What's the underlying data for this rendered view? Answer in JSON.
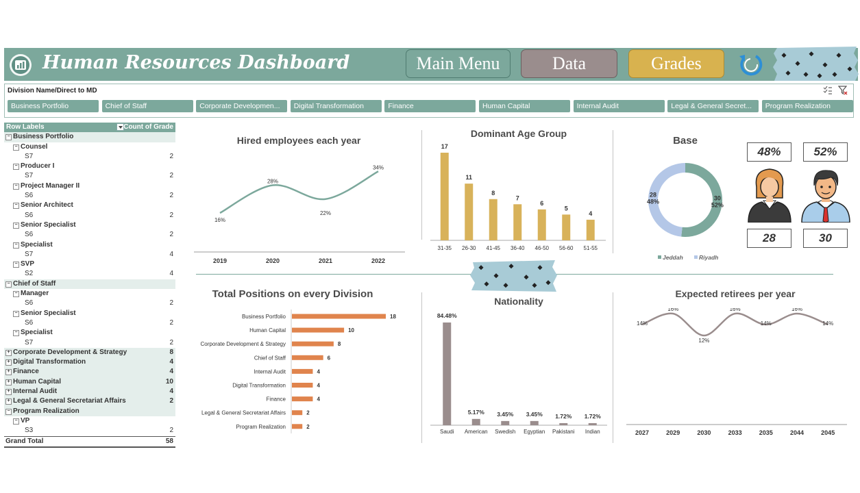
{
  "header": {
    "title": "Human Resources Dashboard",
    "main_menu": "Main Menu",
    "data": "Data",
    "grades": "Grades",
    "color": "#7ca89c"
  },
  "slicer": {
    "title": "Division Name/Direct to MD",
    "items": [
      "Business Portfolio",
      "Chief of Staff",
      "Corporate Developmen...",
      "Digital Transformation",
      "Finance",
      "Human Capital",
      "Internal Audit",
      "Legal & General Secret...",
      "Program Realization"
    ]
  },
  "pivot": {
    "header_label": "Row Labels",
    "header_value": "Count of Grade",
    "rows": [
      {
        "label": "Business Portfolio",
        "value": "",
        "level": 0,
        "sign": "⊟"
      },
      {
        "label": "Counsel",
        "value": "",
        "level": 1,
        "sign": "⊟"
      },
      {
        "label": "S7",
        "value": "2",
        "level": 2,
        "sign": ""
      },
      {
        "label": "Producer I",
        "value": "",
        "level": 1,
        "sign": "⊟"
      },
      {
        "label": "S7",
        "value": "2",
        "level": 2,
        "sign": ""
      },
      {
        "label": "Project Manager II",
        "value": "",
        "level": 1,
        "sign": "⊟"
      },
      {
        "label": "S6",
        "value": "2",
        "level": 2,
        "sign": ""
      },
      {
        "label": "Senior Architect",
        "value": "",
        "level": 1,
        "sign": "⊟"
      },
      {
        "label": "S6",
        "value": "2",
        "level": 2,
        "sign": ""
      },
      {
        "label": "Senior Specialist",
        "value": "",
        "level": 1,
        "sign": "⊟"
      },
      {
        "label": "S6",
        "value": "2",
        "level": 2,
        "sign": ""
      },
      {
        "label": "Specialist",
        "value": "",
        "level": 1,
        "sign": "⊟"
      },
      {
        "label": "S7",
        "value": "4",
        "level": 2,
        "sign": ""
      },
      {
        "label": "SVP",
        "value": "",
        "level": 1,
        "sign": "⊟"
      },
      {
        "label": "S2",
        "value": "4",
        "level": 2,
        "sign": ""
      },
      {
        "label": "Chief of Staff",
        "value": "",
        "level": 0,
        "sign": "⊟"
      },
      {
        "label": "Manager",
        "value": "",
        "level": 1,
        "sign": "⊟"
      },
      {
        "label": "S6",
        "value": "2",
        "level": 2,
        "sign": ""
      },
      {
        "label": "Senior Specialist",
        "value": "",
        "level": 1,
        "sign": "⊟"
      },
      {
        "label": "S6",
        "value": "2",
        "level": 2,
        "sign": ""
      },
      {
        "label": "Specialist",
        "value": "",
        "level": 1,
        "sign": "⊟"
      },
      {
        "label": "S7",
        "value": "2",
        "level": 2,
        "sign": ""
      },
      {
        "label": "Corporate Development & Strategy",
        "value": "8",
        "level": 0,
        "sign": "⊞"
      },
      {
        "label": "Digital Transformation",
        "value": "4",
        "level": 0,
        "sign": "⊞"
      },
      {
        "label": "Finance",
        "value": "4",
        "level": 0,
        "sign": "⊞"
      },
      {
        "label": "Human Capital",
        "value": "10",
        "level": 0,
        "sign": "⊞"
      },
      {
        "label": "Internal Audit",
        "value": "4",
        "level": 0,
        "sign": "⊞"
      },
      {
        "label": "Legal & General Secretariat Affairs",
        "value": "2",
        "level": 0,
        "sign": "⊞"
      },
      {
        "label": "Program Realization",
        "value": "",
        "level": 0,
        "sign": "⊟"
      },
      {
        "label": "VP",
        "value": "",
        "level": 1,
        "sign": "⊟"
      },
      {
        "label": "S3",
        "value": "2",
        "level": 2,
        "sign": ""
      }
    ],
    "grand_total_label": "Grand Total",
    "grand_total_value": "58"
  },
  "base": {
    "title": "Base",
    "female_pct": "48%",
    "male_pct": "52%",
    "female_count": "28",
    "male_count": "30"
  },
  "chart_data": [
    {
      "type": "line",
      "title": "Hired employees each year",
      "categories": [
        "2019",
        "2020",
        "2021",
        "2022"
      ],
      "values": [
        16,
        28,
        22,
        34
      ],
      "labels": [
        "16%",
        "28%",
        "22%",
        "34%"
      ],
      "color": "#7ca89c"
    },
    {
      "type": "bar",
      "title": "Dominant Age Group",
      "categories": [
        "31-35",
        "26-30",
        "41-45",
        "36-40",
        "46-50",
        "56-60",
        "51-55"
      ],
      "values": [
        17,
        11,
        8,
        7,
        6,
        5,
        4
      ],
      "color": "#d8b25a"
    },
    {
      "type": "pie",
      "title": "Base",
      "categories": [
        "Jeddah",
        "Riyadh"
      ],
      "values": [
        30,
        28
      ],
      "labels": [
        [
          "30",
          "52%"
        ],
        [
          "28",
          "48%"
        ]
      ],
      "colors": [
        "#7ca89c",
        "#b4c7e7"
      ]
    },
    {
      "type": "bar",
      "title": "Total Positions on every Division",
      "categories": [
        "Business Portfolio",
        "Human Capital",
        "Corporate Development & Strategy",
        "Chief of Staff",
        "Internal Audit",
        "Digital Transformation",
        "Finance",
        "Legal & General Secretariat Affairs",
        "Program Realization"
      ],
      "values": [
        18,
        10,
        8,
        6,
        4,
        4,
        4,
        2,
        2
      ],
      "color": "#e0844d"
    },
    {
      "type": "bar",
      "title": "Nationality",
      "categories": [
        "Saudi",
        "American",
        "Swedish",
        "Egyptian",
        "Pakistani",
        "Indian"
      ],
      "values": [
        84.48,
        5.17,
        3.45,
        3.45,
        1.72,
        1.72
      ],
      "labels": [
        "84.48%",
        "5.17%",
        "3.45%",
        "3.45%",
        "1.72%",
        "1.72%"
      ],
      "color": "#9a8d8d"
    },
    {
      "type": "line",
      "title": "Expected retirees per year",
      "categories": [
        "2027",
        "2029",
        "2030",
        "2033",
        "2035",
        "2044",
        "2045"
      ],
      "values": [
        14,
        16,
        12,
        16,
        14,
        16,
        14
      ],
      "labels": [
        "14%",
        "16%",
        "12%",
        "16%",
        "14%",
        "16%",
        "14%"
      ],
      "color": "#9a8d8d"
    }
  ]
}
